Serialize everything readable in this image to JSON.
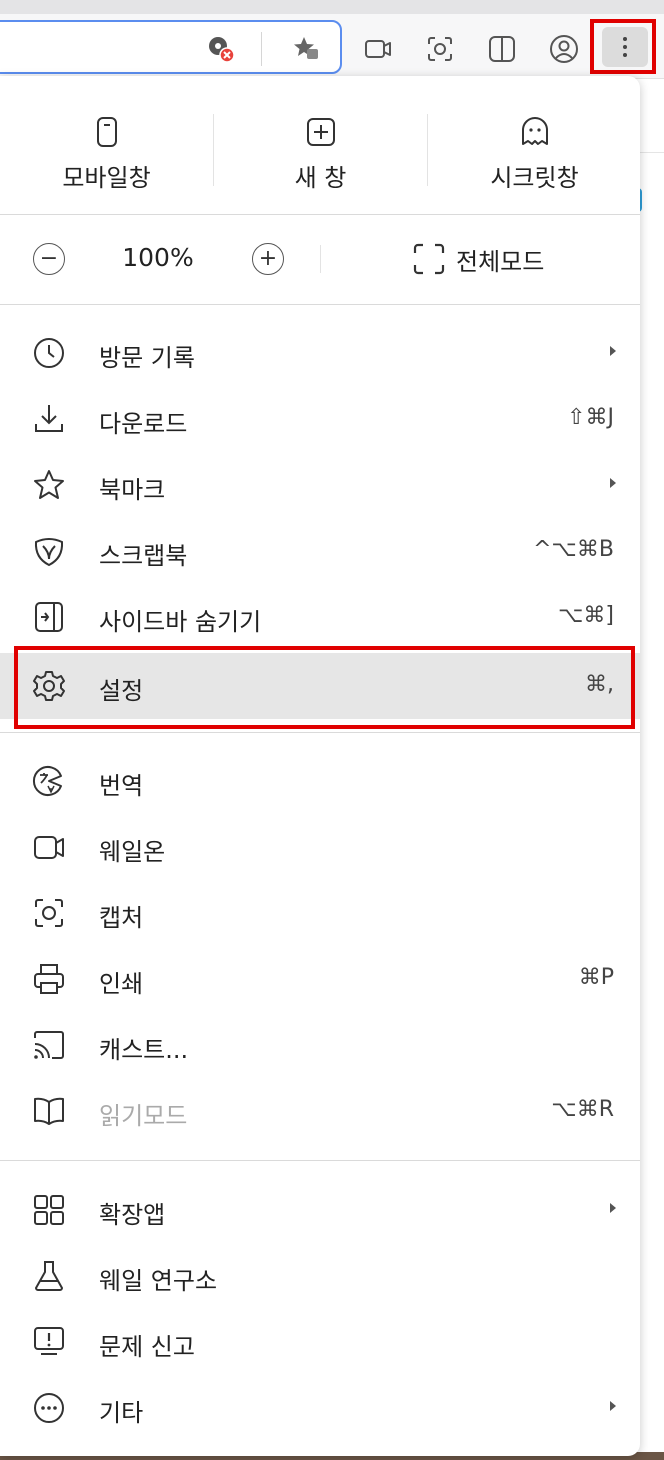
{
  "menu": {
    "quick": [
      {
        "label": "모바일창",
        "icon": "mobile-window-icon"
      },
      {
        "label": "새 창",
        "icon": "new-window-icon"
      },
      {
        "label": "시크릿창",
        "icon": "ghost-icon"
      }
    ],
    "zoom": {
      "minus": "−",
      "value": "100%",
      "plus": "+",
      "fullscreen_label": "전체모드"
    },
    "section1": [
      {
        "label": "방문 기록",
        "shortcut": "",
        "icon": "clock-icon",
        "submenu": true
      },
      {
        "label": "다운로드",
        "shortcut": "⇧⌘J",
        "icon": "download-icon",
        "submenu": false
      },
      {
        "label": "북마크",
        "shortcut": "",
        "icon": "star-icon",
        "submenu": true
      },
      {
        "label": "스크랩북",
        "shortcut": "^⌥⌘B",
        "icon": "scrapbook-icon",
        "submenu": false
      },
      {
        "label": "사이드바 숨기기",
        "shortcut": "⌥⌘]",
        "icon": "sidebar-icon",
        "submenu": false
      },
      {
        "label": "설정",
        "shortcut": "⌘,",
        "icon": "gear-icon",
        "submenu": false,
        "selected": true
      }
    ],
    "section2": [
      {
        "label": "번역",
        "shortcut": "",
        "icon": "translate-icon"
      },
      {
        "label": "웨일온",
        "shortcut": "",
        "icon": "video-icon"
      },
      {
        "label": "캡처",
        "shortcut": "",
        "icon": "capture-icon"
      },
      {
        "label": "인쇄",
        "shortcut": "⌘P",
        "icon": "printer-icon"
      },
      {
        "label": "캐스트...",
        "shortcut": "",
        "icon": "cast-icon"
      },
      {
        "label": "읽기모드",
        "shortcut": "⌥⌘R",
        "icon": "book-icon",
        "disabled": true
      }
    ],
    "section3": [
      {
        "label": "확장앱",
        "icon": "extensions-icon",
        "submenu": true
      },
      {
        "label": "웨일 연구소",
        "icon": "flask-icon",
        "submenu": false
      },
      {
        "label": "문제 신고",
        "icon": "report-icon",
        "submenu": false
      },
      {
        "label": "기타",
        "icon": "more-horizontal-icon",
        "submenu": true
      }
    ]
  },
  "colors": {
    "highlight_box": "#e00000",
    "address_focus": "#5b8def",
    "selected_row": "#e6e6e6",
    "error_badge": "#e8423b"
  }
}
